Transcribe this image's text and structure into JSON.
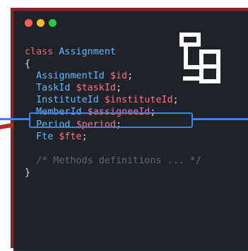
{
  "window": {
    "traffic_lights": [
      {
        "name": "close",
        "color": "#ff5f57"
      },
      {
        "name": "minimize",
        "color": "#febc2e"
      },
      {
        "name": "maximize",
        "color": "#28c840"
      }
    ]
  },
  "code": {
    "lines": [
      {
        "parts": [
          {
            "t": "class ",
            "c": "kw"
          },
          {
            "t": "Assignment",
            "c": "ty"
          }
        ]
      },
      {
        "parts": [
          {
            "t": "{",
            "c": ""
          }
        ]
      },
      {
        "parts": [
          {
            "t": "  AssignmentId ",
            "c": "ty"
          },
          {
            "t": "$id",
            "c": "var"
          },
          {
            "t": ";",
            "c": ""
          }
        ]
      },
      {
        "parts": [
          {
            "t": "  TaskId ",
            "c": "ty"
          },
          {
            "t": "$taskId",
            "c": "var"
          },
          {
            "t": ";",
            "c": ""
          }
        ]
      },
      {
        "parts": [
          {
            "t": "  InstituteId ",
            "c": "ty"
          },
          {
            "t": "$instituteId",
            "c": "var"
          },
          {
            "t": ";",
            "c": ""
          }
        ]
      },
      {
        "parts": [
          {
            "t": "  MemberId ",
            "c": "ty"
          },
          {
            "t": "$assigneeId",
            "c": "var"
          },
          {
            "t": ";",
            "c": ""
          }
        ]
      },
      {
        "parts": [
          {
            "t": "  Period ",
            "c": "ty"
          },
          {
            "t": "$period",
            "c": "var"
          },
          {
            "t": ";",
            "c": ""
          }
        ]
      },
      {
        "parts": [
          {
            "t": "  Fte ",
            "c": "ty"
          },
          {
            "t": "$fte",
            "c": "var"
          },
          {
            "t": ";",
            "c": ""
          }
        ]
      },
      {
        "parts": [
          {
            "t": "",
            "c": ""
          }
        ]
      },
      {
        "parts": [
          {
            "t": "  /* Methods definitions ... */",
            "c": "cm"
          }
        ]
      },
      {
        "parts": [
          {
            "t": "}",
            "c": ""
          }
        ]
      }
    ]
  },
  "highlight": {
    "line_index": 5,
    "color": "#3b82f6"
  },
  "icons": {
    "logo": "structure-icon"
  }
}
